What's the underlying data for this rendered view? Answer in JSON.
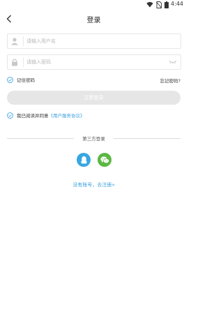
{
  "status_bar": {
    "time": "4:44",
    "icons": [
      "wifi-icon",
      "no-sim-icon",
      "battery-icon"
    ]
  },
  "header": {
    "title": "登录",
    "back_icon": "chevron-left-icon"
  },
  "form": {
    "username": {
      "placeholder": "请输入用户名",
      "value": "",
      "icon": "user-icon"
    },
    "password": {
      "placeholder": "请输入密码",
      "value": "",
      "icon": "lock-icon",
      "toggle_icon": "eye-closed-icon"
    },
    "remember_label": "记住密码",
    "forgot_label": "忘记密码?",
    "login_button": "立即登录",
    "agreement_prefix": "我已阅读并同意",
    "agreement_link": "《用户服务协议》"
  },
  "third_party": {
    "title": "第三方登录",
    "providers": [
      "qq-icon",
      "wechat-icon"
    ]
  },
  "register_link": "没有账号，去注册»",
  "colors": {
    "accent": "#3aa0dd",
    "qq": "#38a7e1",
    "wechat": "#5bb843",
    "button_disabled": "#e6e6e6"
  }
}
